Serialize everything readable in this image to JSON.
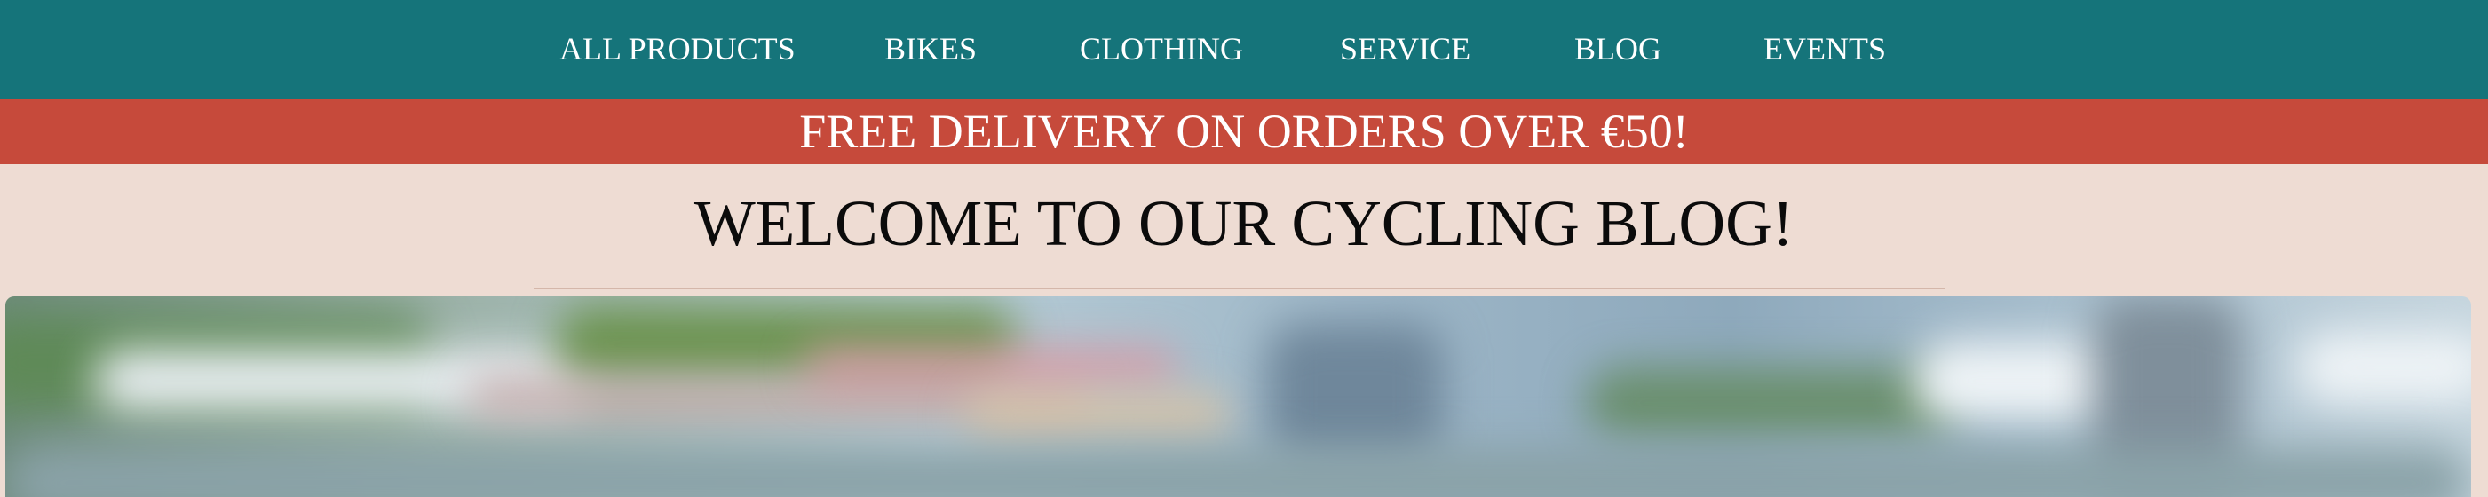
{
  "nav": {
    "items": [
      {
        "label": "ALL PRODUCTS"
      },
      {
        "label": "BIKES"
      },
      {
        "label": "CLOTHING"
      },
      {
        "label": "SERVICE"
      },
      {
        "label": "BLOG"
      },
      {
        "label": "EVENTS"
      }
    ]
  },
  "promo": {
    "text": "FREE DELIVERY ON ORDERS OVER €50!"
  },
  "blog": {
    "title": "WELCOME TO OUR CYCLING BLOG!"
  },
  "colors": {
    "nav_bg": "#15747a",
    "promo_bg": "#c64a3b",
    "page_bg": "#eedcd3"
  }
}
